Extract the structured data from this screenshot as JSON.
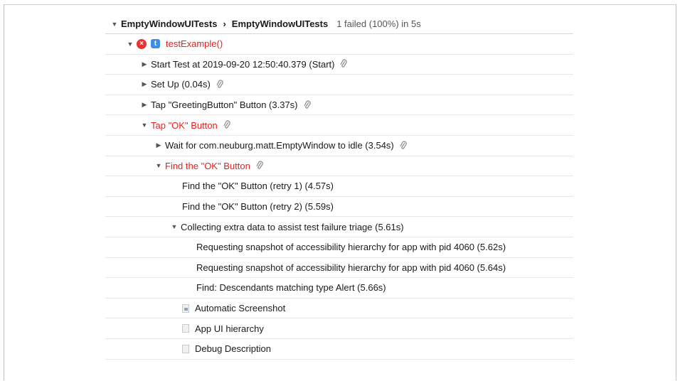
{
  "header": {
    "path_root": "EmptyWindowUITests",
    "separator": "›",
    "path_leaf": "EmptyWindowUITests",
    "summary": "1 failed (100%) in 5s"
  },
  "test": {
    "name": "testExample()",
    "error_glyph": "×",
    "badge": "t"
  },
  "rows": [
    {
      "label": "Start Test at 2019-09-20 12:50:40.379 (Start)"
    },
    {
      "label": "Set Up (0.04s)"
    },
    {
      "label": "Tap \"GreetingButton\" Button (3.37s)"
    },
    {
      "label": "Tap \"OK\" Button"
    },
    {
      "label": "Wait for com.neuburg.matt.EmptyWindow to idle (3.54s)"
    },
    {
      "label": "Find the \"OK\" Button"
    },
    {
      "label": "Find the \"OK\" Button (retry 1) (4.57s)"
    },
    {
      "label": "Find the \"OK\" Button (retry 2) (5.59s)"
    },
    {
      "label": "Collecting extra data to assist test failure triage (5.61s)"
    },
    {
      "label": "Requesting snapshot of accessibility hierarchy for app with pid 4060 (5.62s)"
    },
    {
      "label": "Requesting snapshot of accessibility hierarchy for app with pid 4060 (5.64s)"
    },
    {
      "label": "Find: Descendants matching type Alert (5.66s)"
    },
    {
      "label": "Automatic Screenshot"
    },
    {
      "label": "App UI hierarchy"
    },
    {
      "label": "Debug Description"
    }
  ],
  "colors": {
    "failure": "#e81e1e",
    "error_badge": "#e8342f",
    "test_badge": "#3a8ee6"
  }
}
